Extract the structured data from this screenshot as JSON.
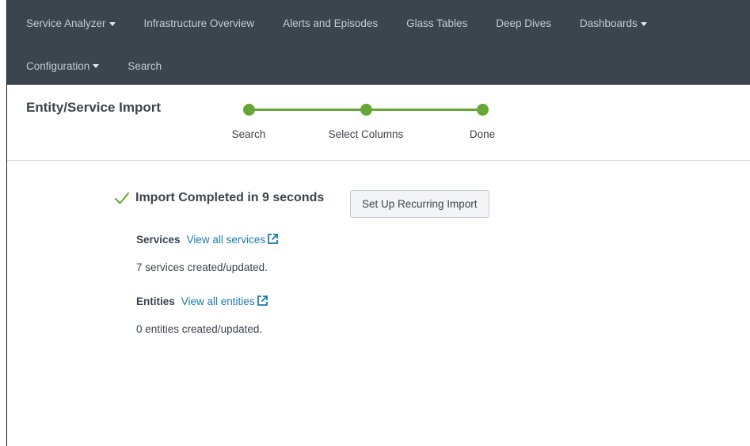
{
  "nav": {
    "row1": [
      {
        "label": "Service Analyzer",
        "caret": true
      },
      {
        "label": "Infrastructure Overview",
        "caret": false
      },
      {
        "label": "Alerts and Episodes",
        "caret": false
      },
      {
        "label": "Glass Tables",
        "caret": false
      },
      {
        "label": "Deep Dives",
        "caret": false
      },
      {
        "label": "Dashboards",
        "caret": true
      }
    ],
    "row2": [
      {
        "label": "Configuration",
        "caret": true
      },
      {
        "label": "Search",
        "caret": false
      }
    ]
  },
  "page": {
    "title": "Entity/Service Import"
  },
  "stepper": {
    "steps": [
      "Search",
      "Select Columns",
      "Done"
    ],
    "current_step": 3,
    "color": "#65a637"
  },
  "result": {
    "status_icon": "checkmark-icon",
    "status_text": "Import Completed in 9 seconds",
    "recurring_button": "Set Up Recurring Import",
    "services": {
      "label": "Services",
      "link": "View all services",
      "link_icon": "external-link-icon",
      "summary": "7 services created/updated."
    },
    "entities": {
      "label": "Entities",
      "link": "View all entities",
      "link_icon": "external-link-icon",
      "summary": "0 entities created/updated."
    }
  },
  "colors": {
    "nav_bg": "#3c444d",
    "nav_text": "#c3cbd4",
    "accent_green": "#65a637",
    "link_blue": "#1a7aaf"
  }
}
